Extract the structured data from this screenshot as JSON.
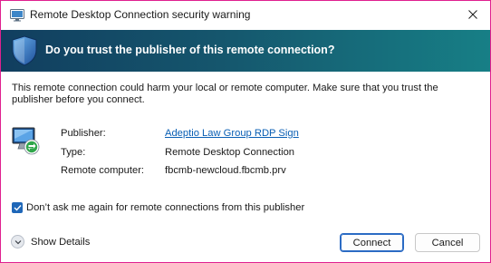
{
  "window": {
    "title": "Remote Desktop Connection security warning"
  },
  "banner": {
    "heading": "Do you trust the publisher of this remote connection?"
  },
  "warning_text": "This remote connection could harm your local or remote computer. Make sure that you trust the publisher before you connect.",
  "details": [
    {
      "label": "Publisher:",
      "value": "Adeptio Law Group RDP Sign"
    },
    {
      "label": "Type:",
      "value": "Remote Desktop Connection"
    },
    {
      "label": "Remote computer:",
      "value": "fbcmb-newcloud.fbcmb.prv"
    }
  ],
  "dont_ask": {
    "label": "Don’t ask me again for remote connections from this publisher",
    "checked": true
  },
  "show_details_label": "Show Details",
  "buttons": {
    "connect": "Connect",
    "cancel": "Cancel"
  },
  "colors": {
    "banner_start": "#113e5f",
    "banner_end": "#177f86",
    "link": "#0a5fb4",
    "checkbox": "#1f67b8",
    "window_border": "#e0208f"
  },
  "icons": {
    "title": "rdp-app-icon",
    "banner": "shield-icon",
    "publisher": "remote-desktop-monitor-icon",
    "close": "close-icon",
    "expand": "chevron-down-icon"
  }
}
